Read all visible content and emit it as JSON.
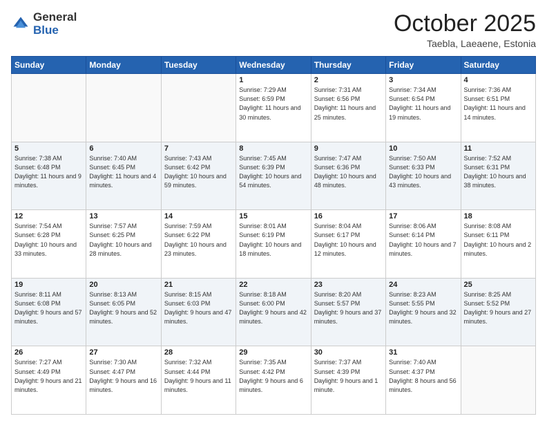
{
  "header": {
    "logo_general": "General",
    "logo_blue": "Blue",
    "month_title": "October 2025",
    "location": "Taebla, Laeaene, Estonia"
  },
  "weekdays": [
    "Sunday",
    "Monday",
    "Tuesday",
    "Wednesday",
    "Thursday",
    "Friday",
    "Saturday"
  ],
  "weeks": [
    [
      {
        "day": "",
        "sunrise": "",
        "sunset": "",
        "daylight": ""
      },
      {
        "day": "",
        "sunrise": "",
        "sunset": "",
        "daylight": ""
      },
      {
        "day": "",
        "sunrise": "",
        "sunset": "",
        "daylight": ""
      },
      {
        "day": "1",
        "sunrise": "Sunrise: 7:29 AM",
        "sunset": "Sunset: 6:59 PM",
        "daylight": "Daylight: 11 hours and 30 minutes."
      },
      {
        "day": "2",
        "sunrise": "Sunrise: 7:31 AM",
        "sunset": "Sunset: 6:56 PM",
        "daylight": "Daylight: 11 hours and 25 minutes."
      },
      {
        "day": "3",
        "sunrise": "Sunrise: 7:34 AM",
        "sunset": "Sunset: 6:54 PM",
        "daylight": "Daylight: 11 hours and 19 minutes."
      },
      {
        "day": "4",
        "sunrise": "Sunrise: 7:36 AM",
        "sunset": "Sunset: 6:51 PM",
        "daylight": "Daylight: 11 hours and 14 minutes."
      }
    ],
    [
      {
        "day": "5",
        "sunrise": "Sunrise: 7:38 AM",
        "sunset": "Sunset: 6:48 PM",
        "daylight": "Daylight: 11 hours and 9 minutes."
      },
      {
        "day": "6",
        "sunrise": "Sunrise: 7:40 AM",
        "sunset": "Sunset: 6:45 PM",
        "daylight": "Daylight: 11 hours and 4 minutes."
      },
      {
        "day": "7",
        "sunrise": "Sunrise: 7:43 AM",
        "sunset": "Sunset: 6:42 PM",
        "daylight": "Daylight: 10 hours and 59 minutes."
      },
      {
        "day": "8",
        "sunrise": "Sunrise: 7:45 AM",
        "sunset": "Sunset: 6:39 PM",
        "daylight": "Daylight: 10 hours and 54 minutes."
      },
      {
        "day": "9",
        "sunrise": "Sunrise: 7:47 AM",
        "sunset": "Sunset: 6:36 PM",
        "daylight": "Daylight: 10 hours and 48 minutes."
      },
      {
        "day": "10",
        "sunrise": "Sunrise: 7:50 AM",
        "sunset": "Sunset: 6:33 PM",
        "daylight": "Daylight: 10 hours and 43 minutes."
      },
      {
        "day": "11",
        "sunrise": "Sunrise: 7:52 AM",
        "sunset": "Sunset: 6:31 PM",
        "daylight": "Daylight: 10 hours and 38 minutes."
      }
    ],
    [
      {
        "day": "12",
        "sunrise": "Sunrise: 7:54 AM",
        "sunset": "Sunset: 6:28 PM",
        "daylight": "Daylight: 10 hours and 33 minutes."
      },
      {
        "day": "13",
        "sunrise": "Sunrise: 7:57 AM",
        "sunset": "Sunset: 6:25 PM",
        "daylight": "Daylight: 10 hours and 28 minutes."
      },
      {
        "day": "14",
        "sunrise": "Sunrise: 7:59 AM",
        "sunset": "Sunset: 6:22 PM",
        "daylight": "Daylight: 10 hours and 23 minutes."
      },
      {
        "day": "15",
        "sunrise": "Sunrise: 8:01 AM",
        "sunset": "Sunset: 6:19 PM",
        "daylight": "Daylight: 10 hours and 18 minutes."
      },
      {
        "day": "16",
        "sunrise": "Sunrise: 8:04 AM",
        "sunset": "Sunset: 6:17 PM",
        "daylight": "Daylight: 10 hours and 12 minutes."
      },
      {
        "day": "17",
        "sunrise": "Sunrise: 8:06 AM",
        "sunset": "Sunset: 6:14 PM",
        "daylight": "Daylight: 10 hours and 7 minutes."
      },
      {
        "day": "18",
        "sunrise": "Sunrise: 8:08 AM",
        "sunset": "Sunset: 6:11 PM",
        "daylight": "Daylight: 10 hours and 2 minutes."
      }
    ],
    [
      {
        "day": "19",
        "sunrise": "Sunrise: 8:11 AM",
        "sunset": "Sunset: 6:08 PM",
        "daylight": "Daylight: 9 hours and 57 minutes."
      },
      {
        "day": "20",
        "sunrise": "Sunrise: 8:13 AM",
        "sunset": "Sunset: 6:05 PM",
        "daylight": "Daylight: 9 hours and 52 minutes."
      },
      {
        "day": "21",
        "sunrise": "Sunrise: 8:15 AM",
        "sunset": "Sunset: 6:03 PM",
        "daylight": "Daylight: 9 hours and 47 minutes."
      },
      {
        "day": "22",
        "sunrise": "Sunrise: 8:18 AM",
        "sunset": "Sunset: 6:00 PM",
        "daylight": "Daylight: 9 hours and 42 minutes."
      },
      {
        "day": "23",
        "sunrise": "Sunrise: 8:20 AM",
        "sunset": "Sunset: 5:57 PM",
        "daylight": "Daylight: 9 hours and 37 minutes."
      },
      {
        "day": "24",
        "sunrise": "Sunrise: 8:23 AM",
        "sunset": "Sunset: 5:55 PM",
        "daylight": "Daylight: 9 hours and 32 minutes."
      },
      {
        "day": "25",
        "sunrise": "Sunrise: 8:25 AM",
        "sunset": "Sunset: 5:52 PM",
        "daylight": "Daylight: 9 hours and 27 minutes."
      }
    ],
    [
      {
        "day": "26",
        "sunrise": "Sunrise: 7:27 AM",
        "sunset": "Sunset: 4:49 PM",
        "daylight": "Daylight: 9 hours and 21 minutes."
      },
      {
        "day": "27",
        "sunrise": "Sunrise: 7:30 AM",
        "sunset": "Sunset: 4:47 PM",
        "daylight": "Daylight: 9 hours and 16 minutes."
      },
      {
        "day": "28",
        "sunrise": "Sunrise: 7:32 AM",
        "sunset": "Sunset: 4:44 PM",
        "daylight": "Daylight: 9 hours and 11 minutes."
      },
      {
        "day": "29",
        "sunrise": "Sunrise: 7:35 AM",
        "sunset": "Sunset: 4:42 PM",
        "daylight": "Daylight: 9 hours and 6 minutes."
      },
      {
        "day": "30",
        "sunrise": "Sunrise: 7:37 AM",
        "sunset": "Sunset: 4:39 PM",
        "daylight": "Daylight: 9 hours and 1 minute."
      },
      {
        "day": "31",
        "sunrise": "Sunrise: 7:40 AM",
        "sunset": "Sunset: 4:37 PM",
        "daylight": "Daylight: 8 hours and 56 minutes."
      },
      {
        "day": "",
        "sunrise": "",
        "sunset": "",
        "daylight": ""
      }
    ]
  ]
}
